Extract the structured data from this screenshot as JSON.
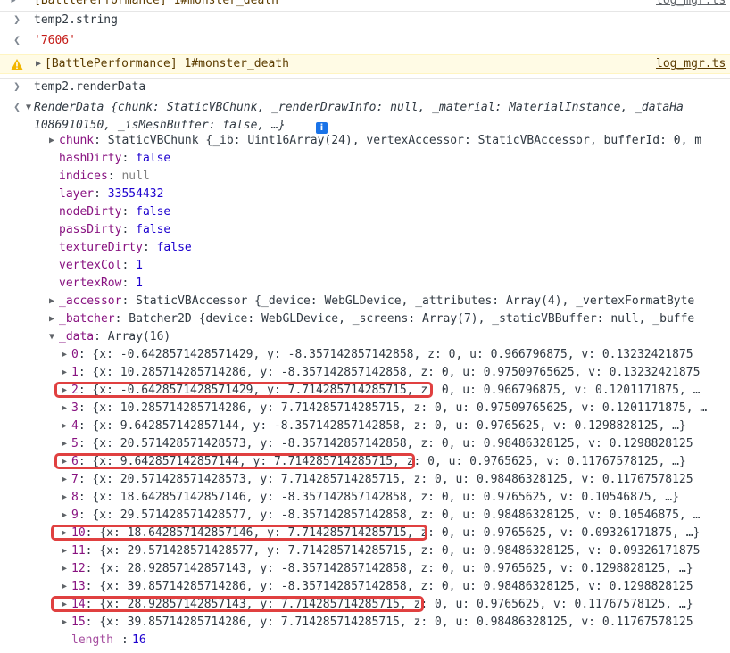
{
  "console": {
    "top_partial": "[BattlePerformance] 1#monster_death",
    "top_partial_link": "log_mgr.ts",
    "input1": "temp2.string",
    "output1": "'7606'",
    "warning_text": "[BattlePerformance] 1#monster_death",
    "warning_link": "log_mgr.ts",
    "input2": "temp2.renderData",
    "render_summary_line1": "RenderData {chunk: StaticVBChunk, _renderDrawInfo: null, _material: MaterialInstance, _dataHa",
    "render_summary_line2": "1086910150, _isMeshBuffer: false, …}",
    "info_badge": "i",
    "props": [
      {
        "key": "chunk",
        "value": "StaticVBChunk {_ib: Uint16Array(24), vertexAccessor: StaticVBAccessor, bufferId: 0, m",
        "expandable": true
      },
      {
        "key": "hashDirty",
        "value": "false"
      },
      {
        "key": "indices",
        "value": "null"
      },
      {
        "key": "layer",
        "value": "33554432"
      },
      {
        "key": "nodeDirty",
        "value": "false"
      },
      {
        "key": "passDirty",
        "value": "false"
      },
      {
        "key": "textureDirty",
        "value": "false"
      },
      {
        "key": "vertexCol",
        "value": "1"
      },
      {
        "key": "vertexRow",
        "value": "1"
      },
      {
        "key": "_accessor",
        "value": "StaticVBAccessor {_device: WebGLDevice, _attributes: Array(4), _vertexFormatByte",
        "expandable": true
      },
      {
        "key": "_batcher",
        "value": "Batcher2D {device: WebGLDevice, _screens: Array(7), _staticVBBuffer: null, _buffe",
        "expandable": true
      },
      {
        "key": "_data",
        "value": "Array(16)",
        "expanded": true
      }
    ],
    "data_items": [
      {
        "index": "0",
        "value": "{x: -0.6428571428571429, y: -8.357142857142858, z: 0, u: 0.966796875, v: 0.13232421875"
      },
      {
        "index": "1",
        "value": "{x: 10.285714285714286, y: -8.357142857142858, z: 0, u: 0.97509765625, v: 0.13232421875"
      },
      {
        "index": "2",
        "value": "{x: -0.6428571428571429, y: 7.714285714285715, z: 0, u: 0.966796875, v: 0.1201171875, …"
      },
      {
        "index": "3",
        "value": "{x: 10.285714285714286, y: 7.714285714285715, z: 0, u: 0.97509765625, v: 0.1201171875, …"
      },
      {
        "index": "4",
        "value": "{x: 9.642857142857144, y: -8.357142857142858, z: 0, u: 0.9765625, v: 0.1298828125, …}"
      },
      {
        "index": "5",
        "value": "{x: 20.571428571428573, y: -8.357142857142858, z: 0, u: 0.98486328125, v: 0.1298828125"
      },
      {
        "index": "6",
        "value": "{x: 9.642857142857144, y: 7.714285714285715, z: 0, u: 0.9765625, v: 0.11767578125, …}"
      },
      {
        "index": "7",
        "value": "{x: 20.571428571428573, y: 7.714285714285715, z: 0, u: 0.98486328125, v: 0.11767578125"
      },
      {
        "index": "8",
        "value": "{x: 18.642857142857146, y: -8.357142857142858, z: 0, u: 0.9765625, v: 0.10546875, …}"
      },
      {
        "index": "9",
        "value": "{x: 29.571428571428577, y: -8.357142857142858, z: 0, u: 0.98486328125, v: 0.10546875, …"
      },
      {
        "index": "10",
        "value": "{x: 18.642857142857146, y: 7.714285714285715, z: 0, u: 0.9765625, v: 0.09326171875, …}"
      },
      {
        "index": "11",
        "value": "{x: 29.571428571428577, y: 7.714285714285715, z: 0, u: 0.98486328125, v: 0.09326171875"
      },
      {
        "index": "12",
        "value": "{x: 28.92857142857143, y: -8.357142857142858, z: 0, u: 0.9765625, v: 0.1298828125, …}"
      },
      {
        "index": "13",
        "value": "{x: 39.85714285714286, y: -8.357142857142858, z: 0, u: 0.98486328125, v: 0.1298828125"
      },
      {
        "index": "14",
        "value": "{x: 28.92857142857143, y: 7.714285714285715, z: 0, u: 0.9765625, v: 0.11767578125, …}"
      },
      {
        "index": "15",
        "value": "{x: 39.85714285714286, y: 7.714285714285715, z: 0, u: 0.98486328125, v: 0.11767578125"
      }
    ],
    "length_key": "length",
    "length_value": "16"
  },
  "colors": {
    "highlight_box": "#e04040",
    "warning_bg": "#fffbe5",
    "property_key": "#881280",
    "number": "#1c00cf"
  }
}
